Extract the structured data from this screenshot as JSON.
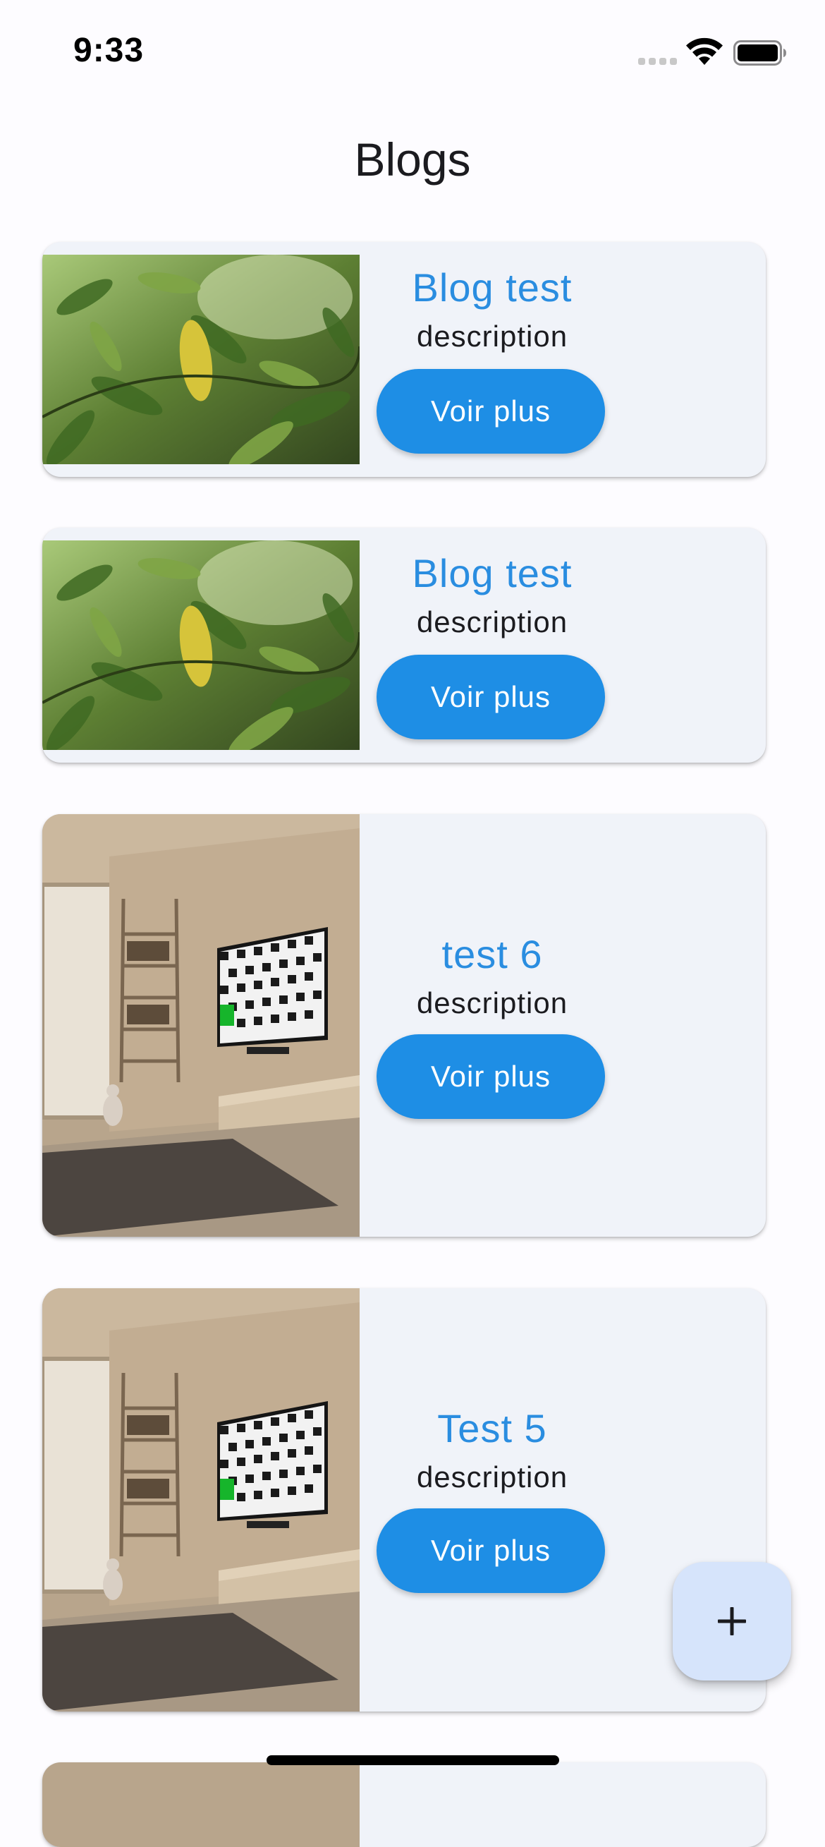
{
  "status_bar": {
    "time": "9:33"
  },
  "app_bar": {
    "title": "Blogs"
  },
  "posts": [
    {
      "title": "Blog test",
      "description": "description",
      "button_label": "Voir plus",
      "image": "leaves-photo"
    },
    {
      "title": "Blog test",
      "description": "description",
      "button_label": "Voir plus",
      "image": "leaves-photo"
    },
    {
      "title": "test 6",
      "description": "description",
      "button_label": "Voir plus",
      "image": "room-photo"
    },
    {
      "title": "Test 5",
      "description": "description",
      "button_label": "Voir plus",
      "image": "room-photo"
    }
  ],
  "fab": {
    "icon": "plus-icon",
    "label": "+"
  },
  "colors": {
    "accent": "#1e8ee5",
    "title": "#2a8de0",
    "card_bg": "#f0f3f9",
    "fab_bg": "#d6e4fb",
    "background": "#fdfcff"
  }
}
